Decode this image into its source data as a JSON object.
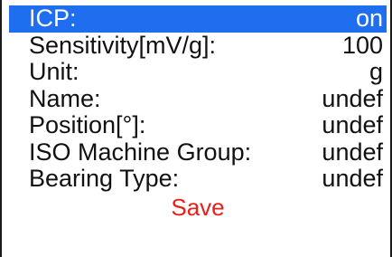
{
  "settings": {
    "items": [
      {
        "label": "ICP:",
        "value": "on"
      },
      {
        "label": "Sensitivity[mV/g]:",
        "value": "100"
      },
      {
        "label": "Unit:",
        "value": "g"
      },
      {
        "label": "Name:",
        "value": "undef"
      },
      {
        "label": "Position[°]:",
        "value": "undef"
      },
      {
        "label": "ISO Machine Group:",
        "value": "undef"
      },
      {
        "label": "Bearing Type:",
        "value": "undef"
      }
    ],
    "selected_index": 0,
    "save_label": "Save"
  },
  "colors": {
    "selection_bg": "#1f6ef0",
    "selection_text": "#ffffff",
    "text": "#111111",
    "save_text": "#e8201a",
    "background": "#ffffff"
  }
}
